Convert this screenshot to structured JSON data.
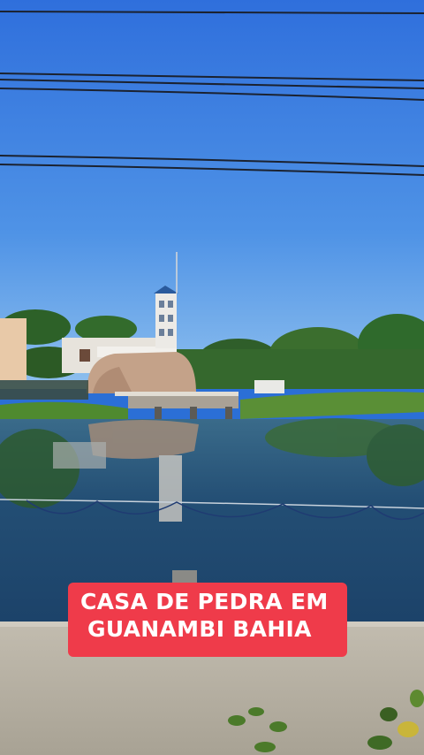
{
  "caption": {
    "line1": "CASA DE PEDRA EM",
    "line2": "GUANAMBI BAHIA"
  },
  "colors": {
    "sky_top": "#2f74e0",
    "sky_bottom": "#7fb4ea",
    "water": "#214d72",
    "grass": "#4f8a2f",
    "rock": "#c4a289",
    "wall": "#b9b3a6",
    "caption_bg": "#ef3b4a"
  }
}
